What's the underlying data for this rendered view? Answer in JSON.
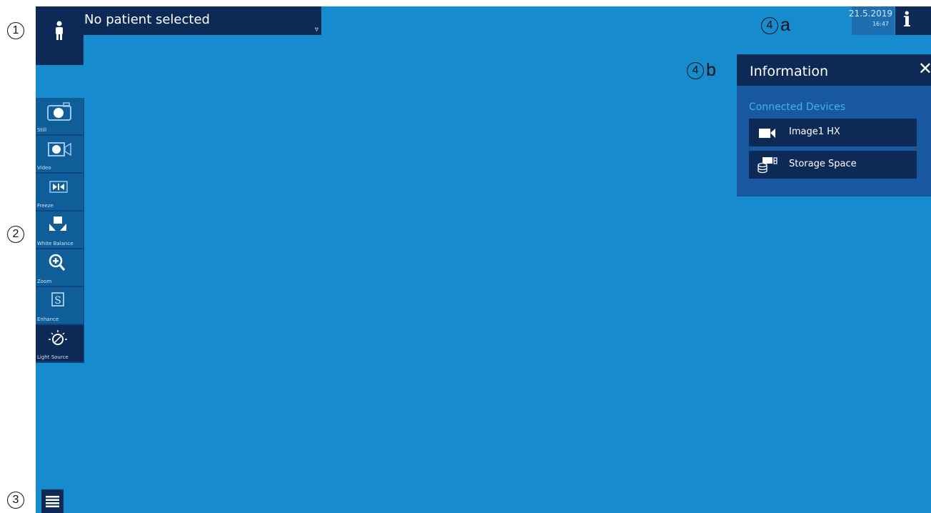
{
  "callouts": [
    {
      "id": "c1",
      "number": "1",
      "suffix": ""
    },
    {
      "id": "c2",
      "number": "2",
      "suffix": ""
    },
    {
      "id": "c3",
      "number": "3",
      "suffix": ""
    },
    {
      "id": "c4a",
      "number": "4",
      "suffix": "a"
    },
    {
      "id": "c4b",
      "number": "4",
      "suffix": "b"
    }
  ],
  "patient": {
    "label": "No patient selected",
    "caret": "▿",
    "icon": "person-icon"
  },
  "toolbar": {
    "items": [
      {
        "label": "Still",
        "icon": "camera-icon"
      },
      {
        "label": "Video",
        "icon": "video-camera-icon"
      },
      {
        "label": "Freeze",
        "icon": "freeze-icon"
      },
      {
        "label": "White Balance",
        "icon": "white-balance-icon"
      },
      {
        "label": "Zoom",
        "icon": "zoom-in-icon"
      },
      {
        "label": "Enhance",
        "icon": "enhance-s-icon"
      },
      {
        "label": "Light Source",
        "icon": "light-source-icon",
        "active": true
      }
    ]
  },
  "menu": {
    "icon": "hamburger-menu-icon"
  },
  "status": {
    "date": "21.5.2019",
    "time": "16:47",
    "info_glyph": "i"
  },
  "info_panel": {
    "title": "Information",
    "close_glyph": "✕",
    "section_title": "Connected Devices",
    "devices": [
      {
        "label": "Image1 HX",
        "icon": "video-camera-icon"
      },
      {
        "label": "Storage Space",
        "icon": "storage-icon"
      }
    ]
  },
  "colors": {
    "background": "#168ccf",
    "dark_panel": "#0c2a55",
    "accent_text": "#3fb4ee"
  }
}
